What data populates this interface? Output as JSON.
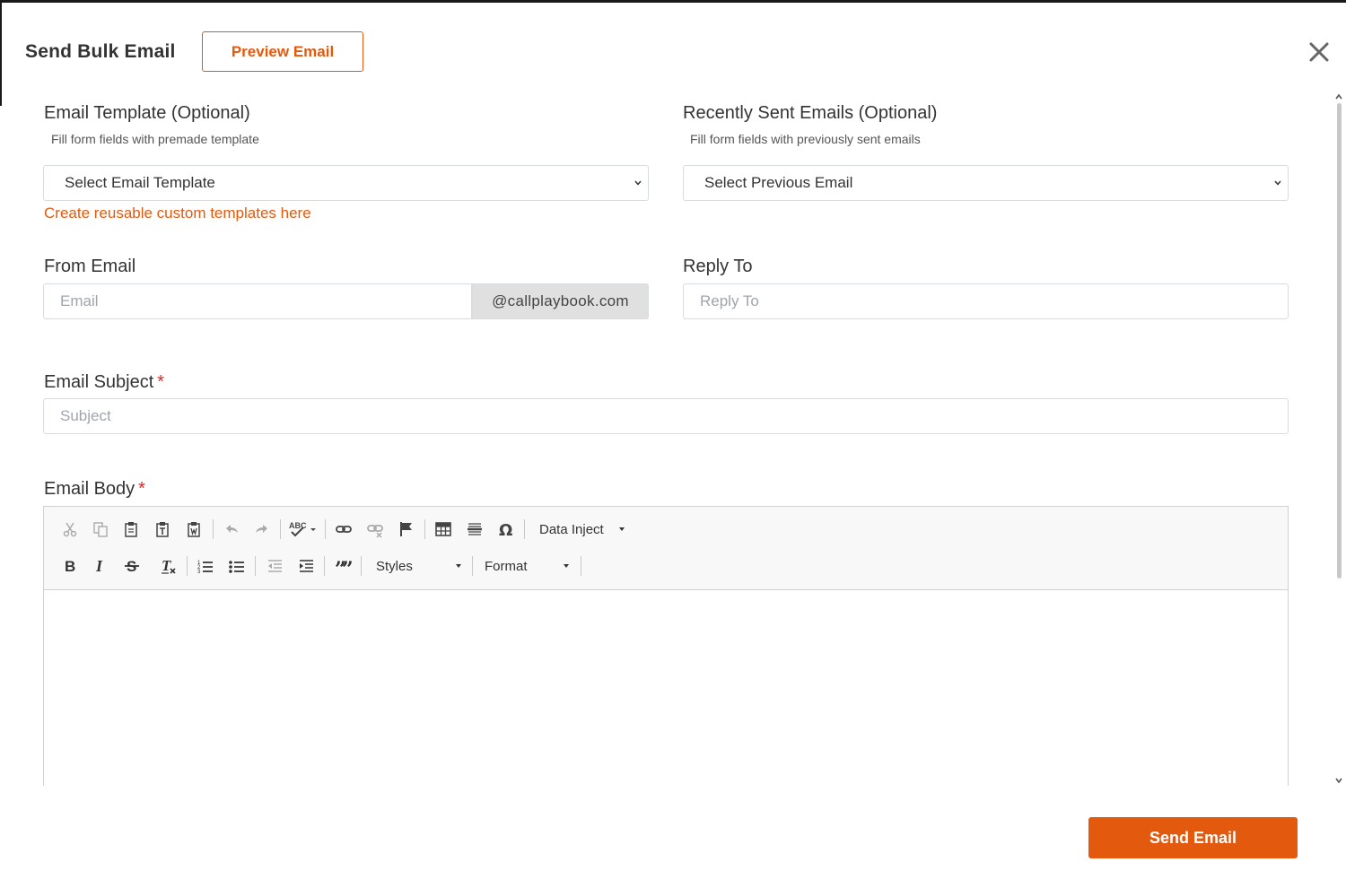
{
  "modal": {
    "title": "Send Bulk Email",
    "preview_button": "Preview Email",
    "close_icon": "close-icon"
  },
  "template": {
    "label": "Email Template (Optional)",
    "help": "Fill form fields with premade template",
    "selected": "Select Email Template",
    "link": "Create reusable custom templates here"
  },
  "recent": {
    "label": "Recently Sent Emails (Optional)",
    "help": "Fill form fields with previously sent emails",
    "selected": "Select Previous Email"
  },
  "from_email": {
    "label": "From Email",
    "placeholder": "Email",
    "domain": "@callplaybook.com"
  },
  "reply_to": {
    "label": "Reply To",
    "placeholder": "Reply To"
  },
  "subject": {
    "label": "Email Subject",
    "required": "*",
    "placeholder": "Subject"
  },
  "body": {
    "label": "Email Body",
    "required": "*",
    "toolbar": {
      "data_inject": "Data Inject",
      "styles": "Styles",
      "format": "Format"
    }
  },
  "send_button": "Send Email",
  "colors": {
    "accent": "#e35a0e",
    "required": "#e02424"
  }
}
